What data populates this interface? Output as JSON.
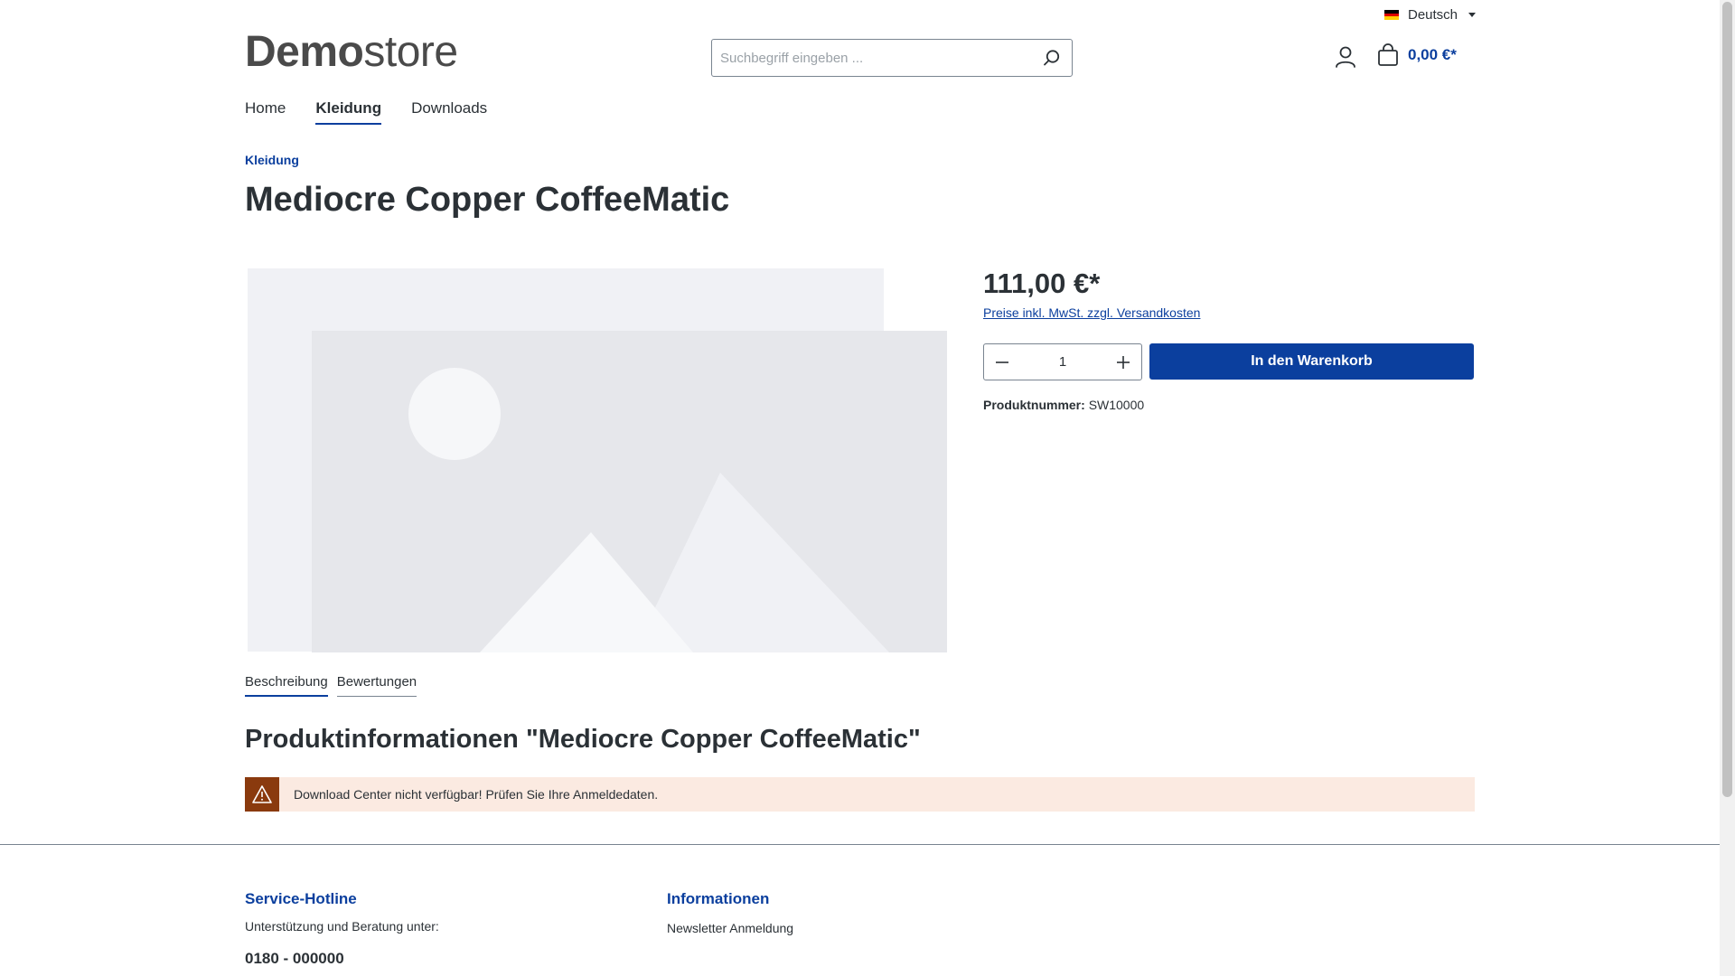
{
  "header": {
    "language": "Deutsch",
    "logo_bold": "Demo",
    "logo_light": "store",
    "search_placeholder": "Suchbegriff eingeben ...",
    "cart_total": "0,00 €*"
  },
  "nav": {
    "items": [
      {
        "label": "Home"
      },
      {
        "label": "Kleidung"
      },
      {
        "label": "Downloads"
      }
    ],
    "active": "Kleidung"
  },
  "product": {
    "breadcrumb": "Kleidung",
    "title": "Mediocre Copper CoffeeMatic",
    "price": "111,00 €*",
    "tax_note": "Preise inkl. MwSt. zzgl. Versandkosten",
    "quantity": "1",
    "buy_label": "In den Warenkorb",
    "number_label": "Produktnummer:",
    "number_value": "SW10000"
  },
  "tabs": [
    {
      "label": "Beschreibung"
    },
    {
      "label": "Bewertungen"
    }
  ],
  "info": {
    "title": "Produktinformationen \"Mediocre Copper CoffeeMatic\"",
    "alert_text": "Download Center nicht verfügbar! Prüfen Sie Ihre Anmeldedaten."
  },
  "footer": {
    "hotline_title": "Service-Hotline",
    "hotline_text": "Unterstützung und Beratung unter:",
    "hotline_phone": "0180 - 000000",
    "info_title": "Informationen",
    "info_link": "Newsletter Anmeldung"
  },
  "colors": {
    "primary": "#0b3f9e",
    "text": "#2b3136",
    "alert_bg": "#fbeae1",
    "alert_icon_bg": "#8a3a0e"
  },
  "icons": [
    "flag-de-icon",
    "caret-down-icon",
    "search-icon",
    "user-icon",
    "bag-icon",
    "minus-icon",
    "plus-icon",
    "warning-icon",
    "image-placeholder-icon"
  ]
}
